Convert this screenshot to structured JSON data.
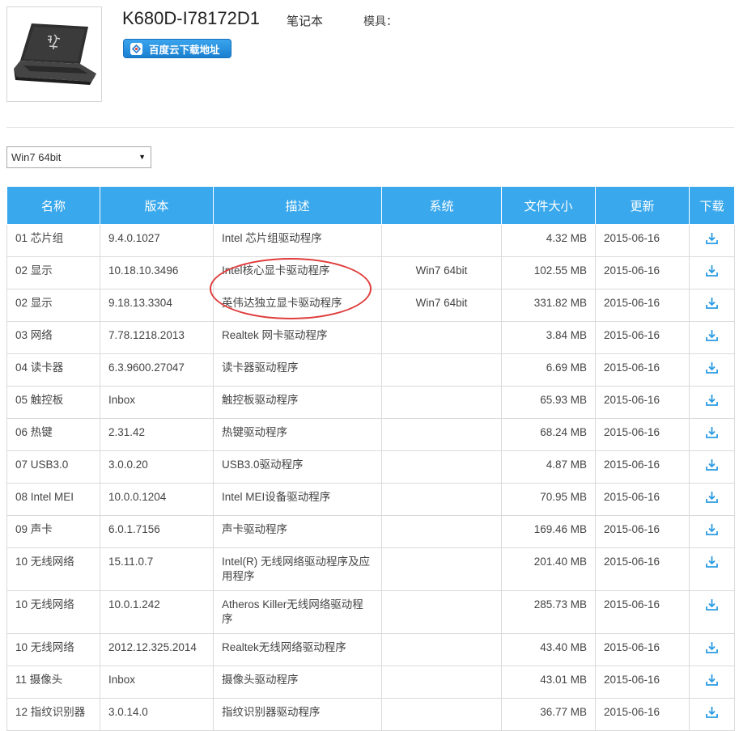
{
  "product": {
    "model": "K680D-I78172D1",
    "category": "笔记本",
    "mold_label": "模具：",
    "download_button": "百度云下载地址",
    "image_icon": "laptop-photo"
  },
  "os_select": {
    "selected": "Win7 64bit"
  },
  "table": {
    "headers": {
      "name": "名称",
      "version": "版本",
      "desc": "描述",
      "system": "系统",
      "size": "文件大小",
      "updated": "更新",
      "download": "下载"
    },
    "rows": [
      {
        "name": "01 芯片组",
        "version": "9.4.0.1027",
        "desc": "Intel 芯片组驱动程序",
        "system": "",
        "size": "4.32 MB",
        "updated": "2015-06-16"
      },
      {
        "name": "02 显示",
        "version": "10.18.10.3496",
        "desc": "Intel核心显卡驱动程序",
        "system": "Win7 64bit",
        "size": "102.55 MB",
        "updated": "2015-06-16"
      },
      {
        "name": "02 显示",
        "version": "9.18.13.3304",
        "desc": "英伟达独立显卡驱动程序",
        "system": "Win7 64bit",
        "size": "331.82 MB",
        "updated": "2015-06-16"
      },
      {
        "name": "03 网络",
        "version": "7.78.1218.2013",
        "desc": "Realtek 网卡驱动程序",
        "system": "",
        "size": "3.84 MB",
        "updated": "2015-06-16"
      },
      {
        "name": "04 读卡器",
        "version": "6.3.9600.27047",
        "desc": "读卡器驱动程序",
        "system": "",
        "size": "6.69 MB",
        "updated": "2015-06-16"
      },
      {
        "name": "05 触控板",
        "version": "Inbox",
        "desc": "触控板驱动程序",
        "system": "",
        "size": "65.93 MB",
        "updated": "2015-06-16"
      },
      {
        "name": "06 热键",
        "version": "2.31.42",
        "desc": "热键驱动程序",
        "system": "",
        "size": "68.24 MB",
        "updated": "2015-06-16"
      },
      {
        "name": "07 USB3.0",
        "version": "3.0.0.20",
        "desc": "USB3.0驱动程序",
        "system": "",
        "size": "4.87 MB",
        "updated": "2015-06-16"
      },
      {
        "name": "08 Intel MEI",
        "version": "10.0.0.1204",
        "desc": "Intel MEI设备驱动程序",
        "system": "",
        "size": "70.95 MB",
        "updated": "2015-06-16"
      },
      {
        "name": "09 声卡",
        "version": "6.0.1.7156",
        "desc": "声卡驱动程序",
        "system": "",
        "size": "169.46 MB",
        "updated": "2015-06-16"
      },
      {
        "name": "10 无线网络",
        "version": "15.11.0.7",
        "desc": "Intel(R) 无线网络驱动程序及应用程序",
        "system": "",
        "size": "201.40 MB",
        "updated": "2015-06-16"
      },
      {
        "name": "10 无线网络",
        "version": "10.0.1.242",
        "desc": "Atheros Killer无线网络驱动程序",
        "system": "",
        "size": "285.73 MB",
        "updated": "2015-06-16"
      },
      {
        "name": "10 无线网络",
        "version": "2012.12.325.2014",
        "desc": "Realtek无线网络驱动程序",
        "system": "",
        "size": "43.40 MB",
        "updated": "2015-06-16"
      },
      {
        "name": "11 摄像头",
        "version": "Inbox",
        "desc": "摄像头驱动程序",
        "system": "",
        "size": "43.01 MB",
        "updated": "2015-06-16"
      },
      {
        "name": "12 指纹识别器",
        "version": "3.0.14.0",
        "desc": "指纹识别器驱动程序",
        "system": "",
        "size": "36.77 MB",
        "updated": "2015-06-16"
      }
    ]
  },
  "colors": {
    "header_bg": "#3aa8ec",
    "download_icon": "#2a9be3",
    "annotation": "#e03c3c",
    "button_bg": "#1f86d6"
  },
  "icons": {
    "download": "download-icon",
    "dropdown": "chevron-down-icon",
    "baidu_cloud": "cloud-icon"
  }
}
